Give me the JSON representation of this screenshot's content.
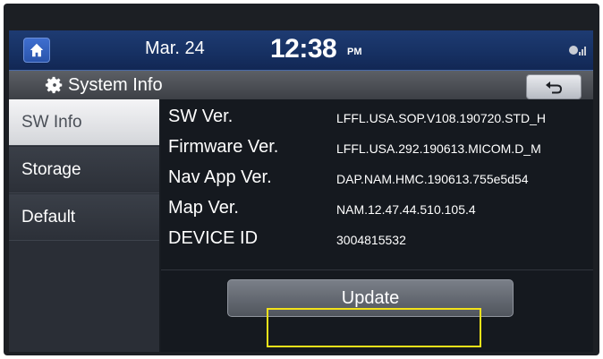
{
  "status": {
    "home_icon": "home-icon",
    "date": "Mar. 24",
    "time": "12:38",
    "ampm": "PM",
    "signal_icon": "signal-icon"
  },
  "header": {
    "title": "System Info",
    "gear_icon": "gear-icon",
    "back_icon": "back-arrow-icon"
  },
  "sidebar": {
    "items": [
      {
        "label": "SW Info",
        "active": true
      },
      {
        "label": "Storage",
        "active": false
      },
      {
        "label": "Default",
        "active": false
      }
    ]
  },
  "info": {
    "rows": [
      {
        "label": "SW Ver.",
        "value": "LFFL.USA.SOP.V108.190720.STD_H"
      },
      {
        "label": "Firmware Ver.",
        "value": "LFFL.USA.292.190613.MICOM.D_M"
      },
      {
        "label": "Nav App Ver.",
        "value": "DAP.NAM.HMC.190613.755e5d54"
      },
      {
        "label": "Map Ver.",
        "value": "NAM.12.47.44.510.105.4"
      },
      {
        "label": "DEVICE ID",
        "value": "3004815532"
      }
    ]
  },
  "actions": {
    "update_label": "Update"
  },
  "colors": {
    "statusbar": "#163062",
    "highlight": "#f2e21a",
    "screen_bg": "#15191f"
  }
}
